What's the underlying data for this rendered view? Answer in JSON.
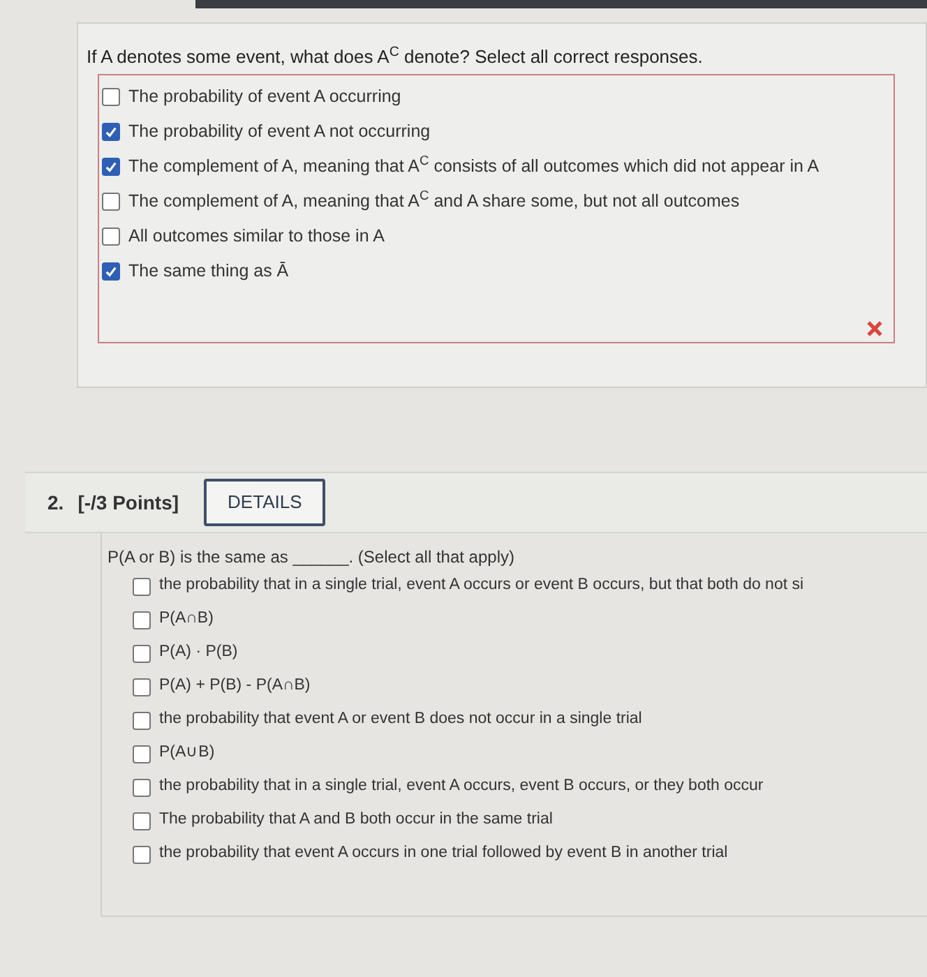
{
  "question_1": {
    "prompt": "If A denotes some event, what does A$^{C}$ denote? Select all correct responses.",
    "options": [
      {
        "label": "The probability of event A occurring",
        "checked": false
      },
      {
        "label": "The probability of event A not occurring",
        "checked": true
      },
      {
        "label": "The complement of A, meaning that A$^{C}$ consists of all outcomes which did not appear in A",
        "checked": true
      },
      {
        "label": "The complement of A, meaning that A$^{C}$ and A share some, but not all outcomes",
        "checked": false
      },
      {
        "label": "All outcomes similar to those in A",
        "checked": false
      },
      {
        "label": "The same thing as Ā",
        "checked": true
      }
    ]
  },
  "question_2": {
    "number": "2.",
    "points": "[-/3 Points]",
    "details_button": "DETAILS",
    "prompt": "P(A or B) is the same as ______. (Select all that apply)",
    "options": [
      {
        "label": "the probability that in a single trial, event A occurs or event B occurs, but that both do not si",
        "checked": false
      },
      {
        "label": "P(A∩B)",
        "checked": false
      },
      {
        "label": "P(A) · P(B)",
        "checked": false
      },
      {
        "label": "P(A) + P(B) - P(A∩B)",
        "checked": false
      },
      {
        "label": "the probability that event A or event B does not occur in a single trial",
        "checked": false
      },
      {
        "label": "P(A∪B)",
        "checked": false
      },
      {
        "label": "the probability that in a single trial, event A occurs, event B occurs, or they both occur",
        "checked": false
      },
      {
        "label": "The probability that A and B both occur in the same trial",
        "checked": false
      },
      {
        "label": "the probability that event A occurs in one trial followed by event B in another trial",
        "checked": false
      }
    ]
  }
}
